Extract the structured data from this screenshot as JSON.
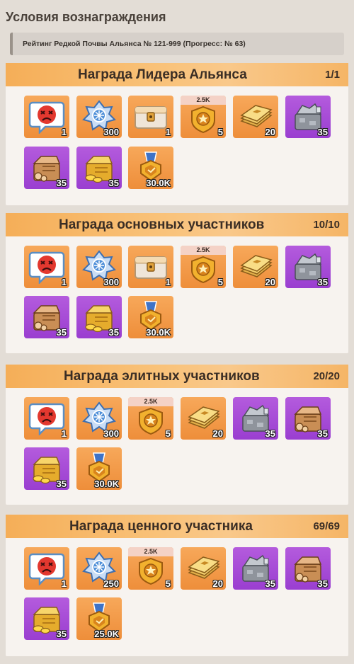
{
  "page": {
    "title": "Условия вознаграждения",
    "progress_text": "Рейтинг Редкой Почвы Альянса № 121-999 (Прогресс:  № 63)"
  },
  "sections": [
    {
      "title": "Награда Лидера Альянса",
      "count": "1/1",
      "items": [
        {
          "icon": "angry-face-icon",
          "qty": "1",
          "bg": "orange"
        },
        {
          "icon": "crystal-shard-icon",
          "qty": "300",
          "bg": "orange"
        },
        {
          "icon": "treasure-chest-icon",
          "qty": "1",
          "bg": "orange"
        },
        {
          "icon": "badge-icon",
          "qty": "5",
          "bg": "orange",
          "tag": "2.5K"
        },
        {
          "icon": "gold-bars-icon",
          "qty": "20",
          "bg": "orange"
        },
        {
          "icon": "stone-pile-icon",
          "qty": "35",
          "bg": "purple"
        },
        {
          "icon": "wood-pile-icon",
          "qty": "35",
          "bg": "purple"
        },
        {
          "icon": "gold-pile-icon",
          "qty": "35",
          "bg": "purple"
        },
        {
          "icon": "medal-icon",
          "qty": "30.0K",
          "bg": "orange"
        }
      ]
    },
    {
      "title": "Награда основных участников",
      "count": "10/10",
      "items": [
        {
          "icon": "angry-face-icon",
          "qty": "1",
          "bg": "orange"
        },
        {
          "icon": "crystal-shard-icon",
          "qty": "300",
          "bg": "orange"
        },
        {
          "icon": "treasure-chest-icon",
          "qty": "1",
          "bg": "orange"
        },
        {
          "icon": "badge-icon",
          "qty": "5",
          "bg": "orange",
          "tag": "2.5K"
        },
        {
          "icon": "gold-bars-icon",
          "qty": "20",
          "bg": "orange"
        },
        {
          "icon": "stone-pile-icon",
          "qty": "35",
          "bg": "purple"
        },
        {
          "icon": "wood-pile-icon",
          "qty": "35",
          "bg": "purple"
        },
        {
          "icon": "gold-pile-icon",
          "qty": "35",
          "bg": "purple"
        },
        {
          "icon": "medal-icon",
          "qty": "30.0K",
          "bg": "orange"
        }
      ]
    },
    {
      "title": "Награда элитных участников",
      "count": "20/20",
      "items": [
        {
          "icon": "angry-face-icon",
          "qty": "1",
          "bg": "orange"
        },
        {
          "icon": "crystal-shard-icon",
          "qty": "300",
          "bg": "orange"
        },
        {
          "icon": "badge-icon",
          "qty": "5",
          "bg": "orange",
          "tag": "2.5K"
        },
        {
          "icon": "gold-bars-icon",
          "qty": "20",
          "bg": "orange"
        },
        {
          "icon": "stone-pile-icon",
          "qty": "35",
          "bg": "purple"
        },
        {
          "icon": "wood-pile-icon",
          "qty": "35",
          "bg": "purple"
        },
        {
          "icon": "gold-pile-icon",
          "qty": "35",
          "bg": "purple"
        },
        {
          "icon": "medal-icon",
          "qty": "30.0K",
          "bg": "orange"
        }
      ]
    },
    {
      "title": "Награда ценного участника",
      "count": "69/69",
      "items": [
        {
          "icon": "angry-face-icon",
          "qty": "1",
          "bg": "orange"
        },
        {
          "icon": "crystal-shard-icon",
          "qty": "250",
          "bg": "orange"
        },
        {
          "icon": "badge-icon",
          "qty": "5",
          "bg": "orange",
          "tag": "2.5K"
        },
        {
          "icon": "gold-bars-icon",
          "qty": "20",
          "bg": "orange"
        },
        {
          "icon": "stone-pile-icon",
          "qty": "35",
          "bg": "purple"
        },
        {
          "icon": "wood-pile-icon",
          "qty": "35",
          "bg": "purple"
        },
        {
          "icon": "gold-pile-icon",
          "qty": "35",
          "bg": "purple"
        },
        {
          "icon": "medal-icon",
          "qty": "25.0K",
          "bg": "orange"
        }
      ]
    }
  ]
}
